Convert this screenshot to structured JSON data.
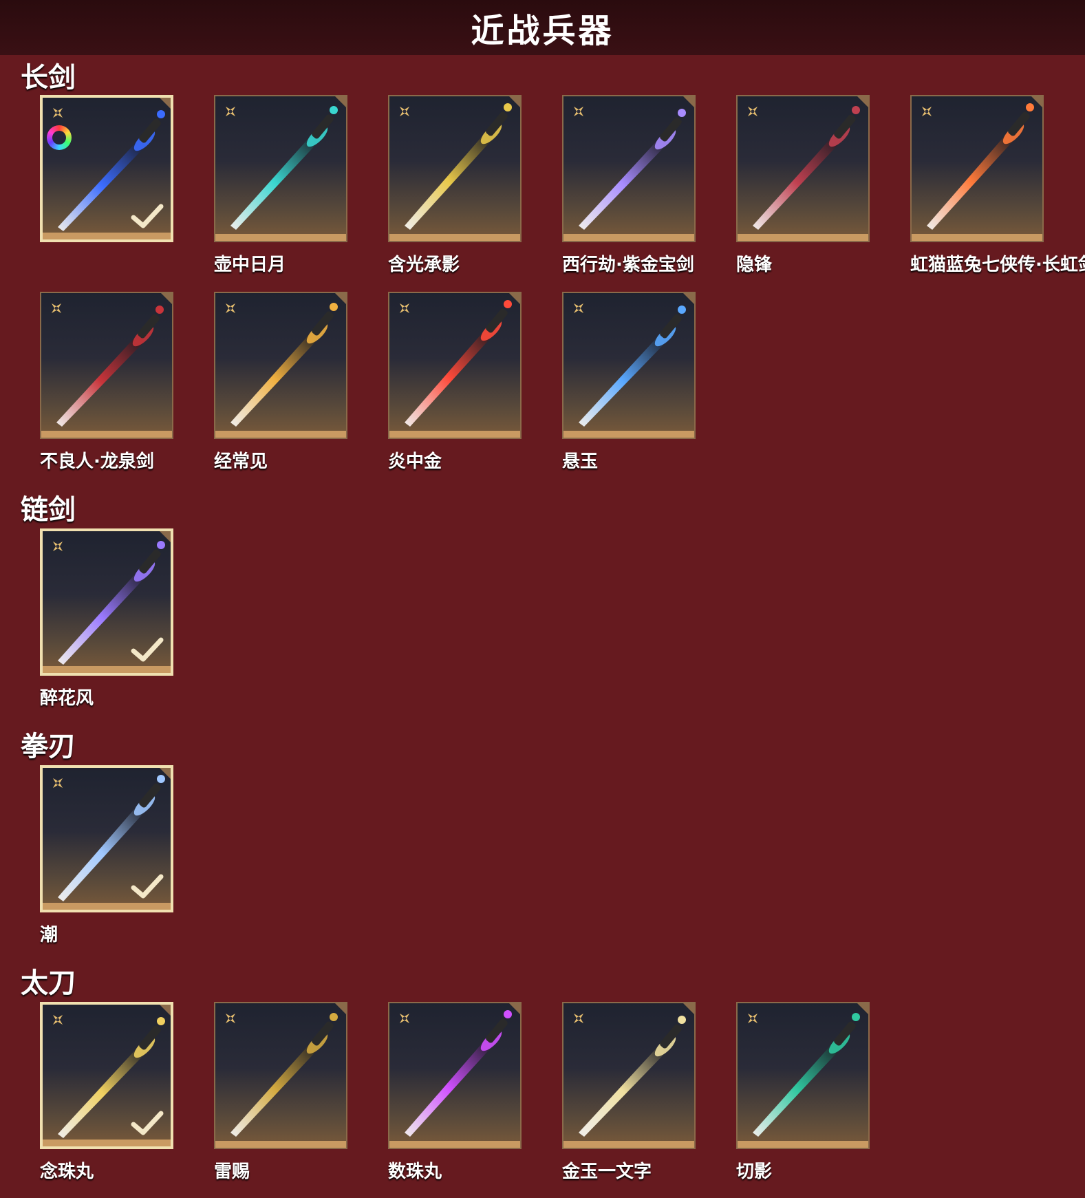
{
  "header": {
    "title": "近战兵器"
  },
  "sections": {
    "longsword": {
      "title": "长剑",
      "items": [
        {
          "name": "",
          "color": "#3b6cff",
          "equipped": true
        },
        {
          "name": "壶中日月",
          "color": "#3ad6d0"
        },
        {
          "name": "含光承影",
          "color": "#e8c84a"
        },
        {
          "name": "西行劫·紫金宝剑",
          "color": "#a88cff"
        },
        {
          "name": "隐锋",
          "color": "#c04050"
        },
        {
          "name": "虹猫蓝兔七侠传·长虹剑",
          "color": "#ff7a3a"
        },
        {
          "name": "不良人·龙泉剑",
          "color": "#c8343a"
        },
        {
          "name": "经常见",
          "color": "#f0b040"
        },
        {
          "name": "炎中金",
          "color": "#ff4a3a"
        },
        {
          "name": "悬玉",
          "color": "#5aa8ff"
        }
      ]
    },
    "chainsword": {
      "title": "链剑",
      "items": [
        {
          "name": "醉花风",
          "color": "#9a7aff",
          "equipped": true
        }
      ]
    },
    "fistblade": {
      "title": "拳刃",
      "items": [
        {
          "name": "潮",
          "color": "#a0c8ff",
          "equipped": true
        }
      ]
    },
    "katana": {
      "title": "太刀",
      "items": [
        {
          "name": "念珠丸",
          "color": "#f0d060",
          "equipped": true
        },
        {
          "name": "雷赐",
          "color": "#d4aa40"
        },
        {
          "name": "数珠丸",
          "color": "#d050ff"
        },
        {
          "name": "金玉一文字",
          "color": "#f0e0a0"
        },
        {
          "name": "切影",
          "color": "#30c8a0"
        }
      ]
    }
  }
}
